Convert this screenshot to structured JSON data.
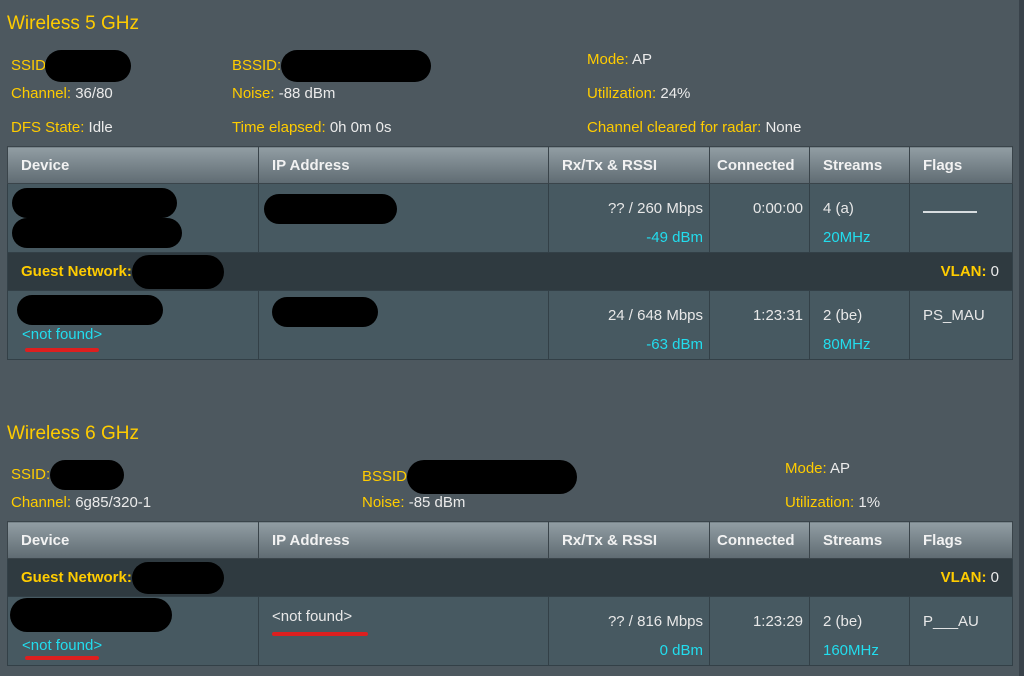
{
  "sections": [
    {
      "title": "Wireless 5 GHz",
      "info": {
        "ssid_label": "SSID",
        "bssid_label": "BSSID:",
        "mode_label": "Mode:",
        "mode_value": "AP",
        "channel_label": "Channel:",
        "channel_value": "36/80",
        "noise_label": "Noise:",
        "noise_value": "-88 dBm",
        "utilization_label": "Utilization:",
        "utilization_value": "24%",
        "dfs_label": "DFS State:",
        "dfs_value": "Idle",
        "elapsed_label": "Time elapsed:",
        "elapsed_value": "0h 0m 0s",
        "radar_label": "Channel cleared for radar:",
        "radar_value": "None"
      },
      "columns": [
        "Device",
        "IP Address",
        "Rx/Tx & RSSI",
        "Connected",
        "Streams",
        "Flags"
      ],
      "rows": [
        {
          "rate": "?? / 260 Mbps",
          "rssi": "-49 dBm",
          "connected": "0:00:00",
          "streams": "4 (a)",
          "bandwidth": "20MHz",
          "flags": "______"
        }
      ],
      "guest": {
        "label": "Guest Network:",
        "vlan_label": "VLAN:",
        "vlan_value": "0"
      },
      "guest_rows": [
        {
          "device_sub": "<not found>",
          "rate": "24 / 648 Mbps",
          "rssi": "-63 dBm",
          "connected": "1:23:31",
          "streams": "2 (be)",
          "bandwidth": "80MHz",
          "flags": "PS_MAU"
        }
      ]
    },
    {
      "title": "Wireless 6 GHz",
      "info": {
        "ssid_label": "SSID:",
        "bssid_label": "BSSID",
        "mode_label": "Mode:",
        "mode_value": "AP",
        "channel_label": "Channel:",
        "channel_value": "6g85/320-1",
        "noise_label": "Noise:",
        "noise_value": "-85 dBm",
        "utilization_label": "Utilization:",
        "utilization_value": "1%"
      },
      "columns": [
        "Device",
        "IP Address",
        "Rx/Tx & RSSI",
        "Connected",
        "Streams",
        "Flags"
      ],
      "guest": {
        "label": "Guest Network:",
        "vlan_label": "VLAN:",
        "vlan_value": "0"
      },
      "guest_rows": [
        {
          "device_sub": "<not found>",
          "ip": "<not found>",
          "rate": "?? / 816 Mbps",
          "rssi": "0 dBm",
          "connected": "1:23:29",
          "streams": "2 (be)",
          "bandwidth": "160MHz",
          "flags": "P___AU"
        }
      ]
    }
  ]
}
